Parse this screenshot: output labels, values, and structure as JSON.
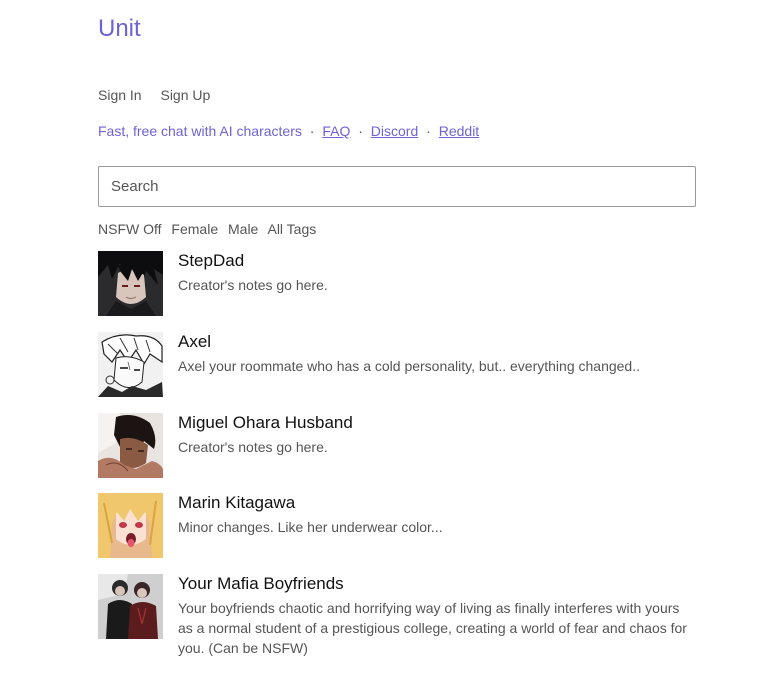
{
  "header": {
    "logo": "Unit",
    "sign_in": "Sign In",
    "sign_up": "Sign Up"
  },
  "tagline": {
    "text": "Fast, free chat with AI characters",
    "faq": "FAQ",
    "discord": "Discord",
    "reddit": "Reddit",
    "separator": "·"
  },
  "search": {
    "placeholder": "Search"
  },
  "filters": {
    "nsfw": "NSFW Off",
    "female": "Female",
    "male": "Male",
    "all_tags": "All Tags"
  },
  "characters": [
    {
      "name": "StepDad",
      "description": "Creator's notes go here.",
      "avatar": "dark-haired-anime-man-portrait"
    },
    {
      "name": "Axel",
      "description": "Axel your roommate who has a cold personality, but.. everything changed..",
      "avatar": "monochrome-manga-boy-portrait"
    },
    {
      "name": "Miguel Ohara Husband",
      "description": "Creator's notes go here.",
      "avatar": "dark-haired-man-with-tan-skin"
    },
    {
      "name": "Marin Kitagawa",
      "description": "Minor changes. Like her underwear color...",
      "avatar": "blonde-anime-girl-portrait"
    },
    {
      "name": "Your Mafia Boyfriends",
      "description": "Your boyfriends chaotic and horrifying way of living as finally interferes with yours as a normal student of a prestigious college, creating a world of fear and chaos for you. (Can be NSFW)",
      "avatar": "two-men-in-dark-suits"
    }
  ],
  "colors": {
    "accent": "#6c63d6",
    "muted_text": "#555555"
  }
}
